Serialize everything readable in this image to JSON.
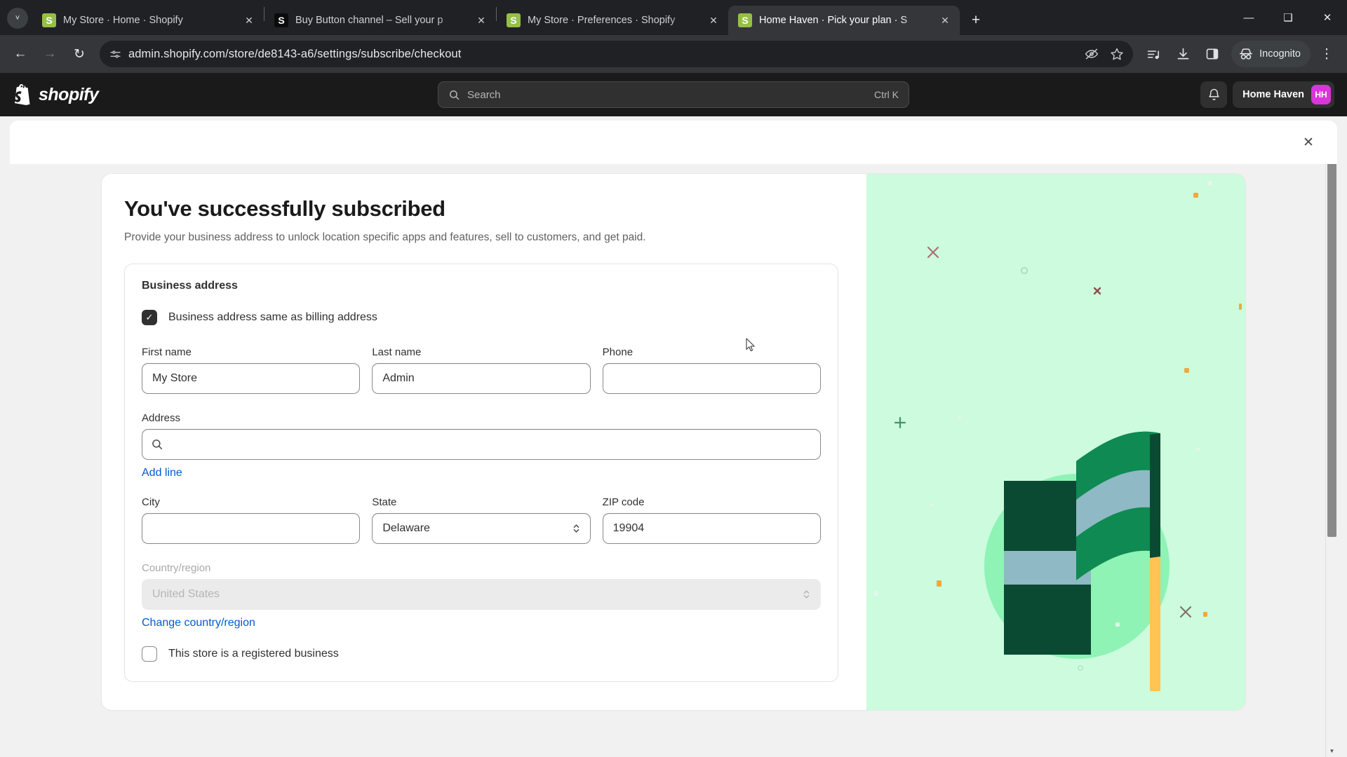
{
  "browser": {
    "tabs": [
      {
        "title": "My Store · Home · Shopify",
        "favicon": "shopify-icon",
        "active": false,
        "close_label": "✕"
      },
      {
        "title": "Buy Button channel – Sell your p",
        "favicon": "shopify-dark-icon",
        "active": false,
        "close_label": "✕"
      },
      {
        "title": "My Store · Preferences · Shopify",
        "favicon": "shopify-icon",
        "active": false,
        "close_label": "✕"
      },
      {
        "title": "Home Haven · Pick your plan · S",
        "favicon": "shopify-icon",
        "active": true,
        "close_label": "✕"
      }
    ],
    "new_tab_label": "+",
    "tab_list_label": "˅",
    "window": {
      "minimize": "—",
      "maximize": "❑",
      "close": "✕"
    },
    "nav": {
      "back": "←",
      "forward": "→",
      "reload": "↻"
    },
    "url": "admin.shopify.com/store/de8143-a6/settings/subscribe/checkout",
    "incognito_label": "Incognito",
    "menu_label": "⋮"
  },
  "shopify_header": {
    "brand": "shopify",
    "search": {
      "placeholder": "Search",
      "shortcut": "Ctrl K"
    },
    "store_name": "Home Haven",
    "store_initials": "HH"
  },
  "modal": {
    "close_label": "✕"
  },
  "main": {
    "title": "You've successfully subscribed",
    "subtitle": "Provide your business address to unlock location specific apps and features, sell to customers, and get paid.",
    "section_title": "Business address",
    "same_as_billing": {
      "label": "Business address same as billing address",
      "checked": true,
      "check_glyph": "✓"
    },
    "fields": {
      "first_name": {
        "label": "First name",
        "value": "My Store"
      },
      "last_name": {
        "label": "Last name",
        "value": "Admin"
      },
      "phone": {
        "label": "Phone",
        "value": ""
      },
      "address": {
        "label": "Address",
        "value": ""
      },
      "city": {
        "label": "City",
        "value": ""
      },
      "state": {
        "label": "State",
        "value": "Delaware"
      },
      "zip": {
        "label": "ZIP code",
        "value": "19904"
      },
      "country": {
        "label": "Country/region",
        "value": "United States",
        "disabled": true
      }
    },
    "add_line_label": "Add line",
    "change_country_label": "Change country/region",
    "registered_business": {
      "label": "This store is a registered business",
      "checked": false
    }
  },
  "colors": {
    "accent_link": "#005bd3",
    "illustration_bg": "#ccfbde",
    "illustration_circle": "#8ef3b5",
    "flag_green": "#108043",
    "flag_dark": "#0b4a32",
    "flag_blue": "#8fb9c4",
    "flag_pole": "#ffc453",
    "avatar_bg": "#d936d9"
  }
}
